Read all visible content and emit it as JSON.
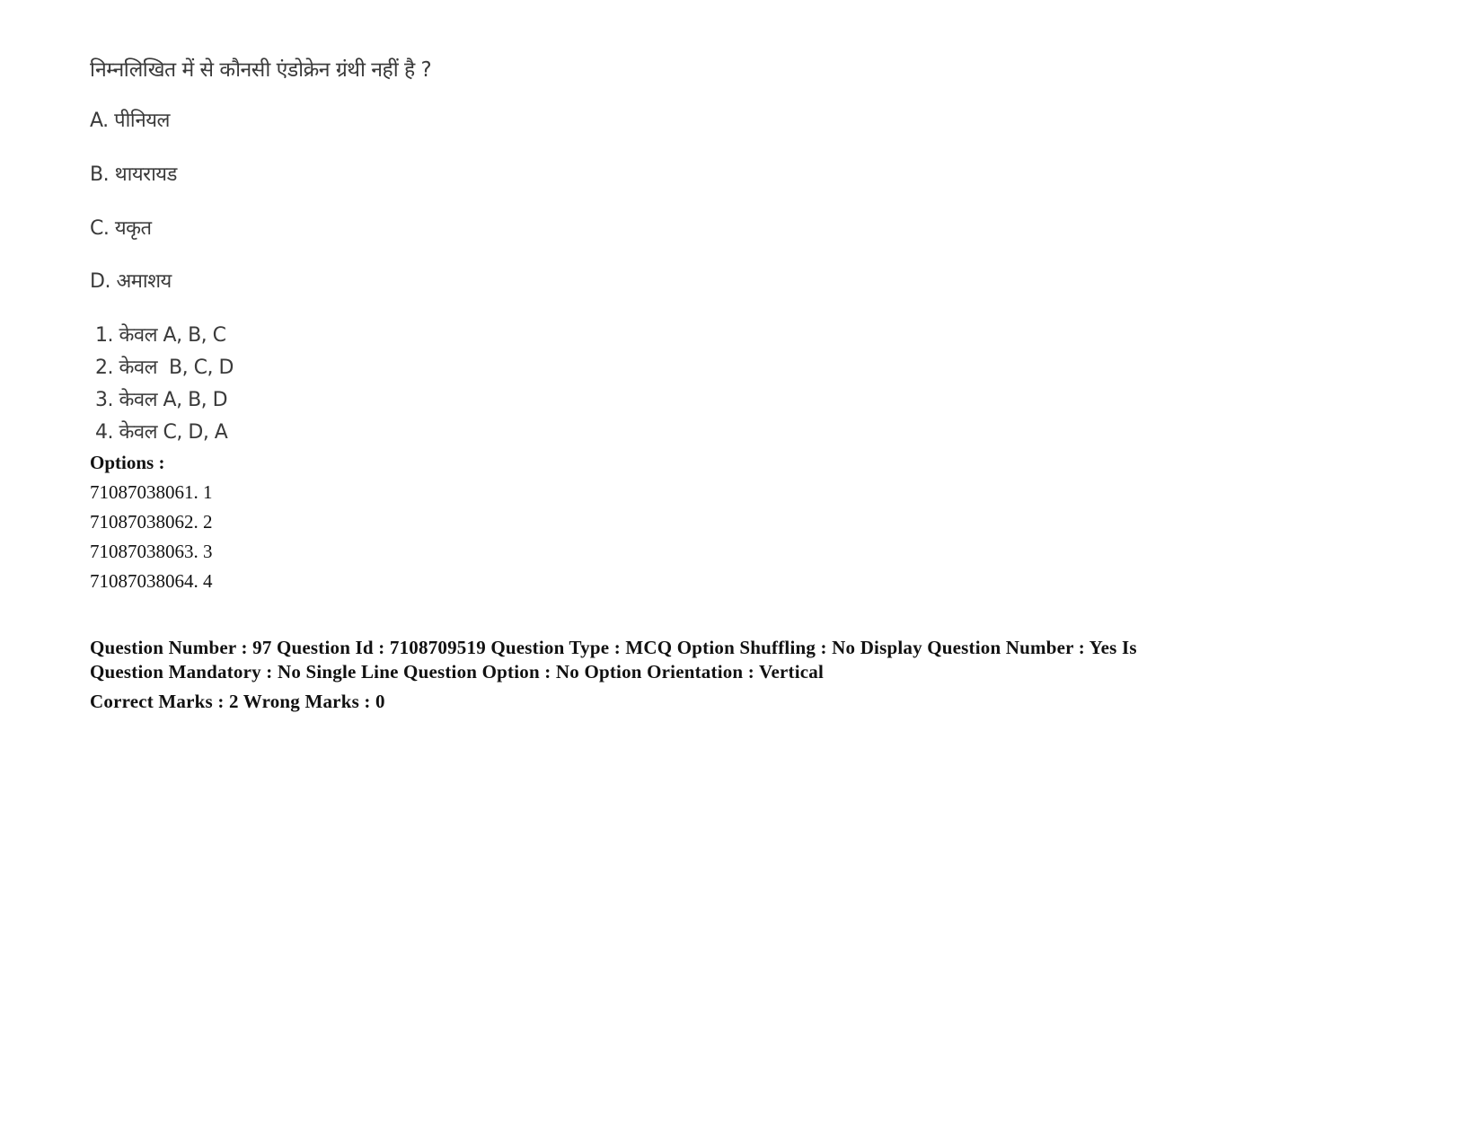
{
  "question": {
    "stem": "निम्नलिखित में से कौनसी एंडोक्रेन ग्रंथी नहीं है ?",
    "statements": [
      {
        "label": "A.",
        "text": "पीनियल"
      },
      {
        "label": "B.",
        "text": "थायरायड"
      },
      {
        "label": "C.",
        "text": "यकृत"
      },
      {
        "label": "D.",
        "text": "अमाशय"
      }
    ],
    "choices": [
      {
        "num": "1.",
        "text": "केवल A, B, C"
      },
      {
        "num": "2.",
        "text": "केवल  B, C, D"
      },
      {
        "num": "3.",
        "text": "केवल A, B, D"
      },
      {
        "num": "4.",
        "text": "केवल C, D, A"
      }
    ]
  },
  "options": {
    "heading": "Options :",
    "items": [
      {
        "id": "71087038061.",
        "value": "1"
      },
      {
        "id": "71087038062.",
        "value": "2"
      },
      {
        "id": "71087038063.",
        "value": "3"
      },
      {
        "id": "71087038064.",
        "value": "4"
      }
    ]
  },
  "metadata": {
    "line1": "Question Number : 97 Question Id : 7108709519 Question Type : MCQ Option Shuffling : No Display Question Number : Yes Is",
    "line2": "Question Mandatory : No Single Line Question Option : No Option Orientation : Vertical",
    "marks": "Correct Marks : 2 Wrong Marks : 0"
  }
}
